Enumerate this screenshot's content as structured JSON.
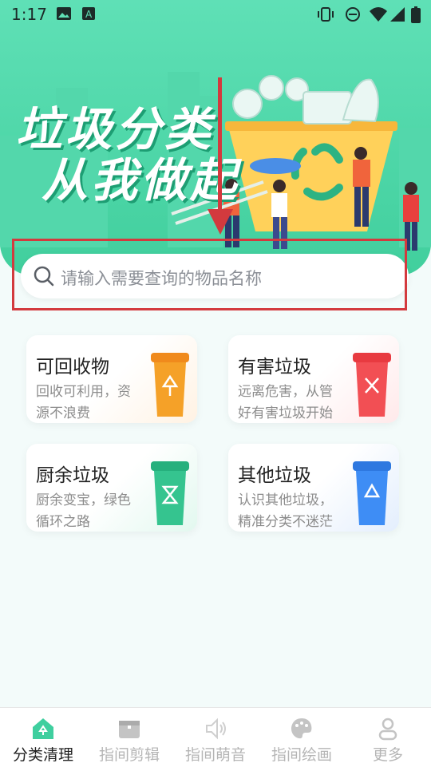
{
  "status_bar": {
    "time": "1:17"
  },
  "banner": {
    "line1": "垃圾分类",
    "line2": "从我做起"
  },
  "search": {
    "placeholder": "请输入需要查询的物品名称"
  },
  "categories": [
    {
      "title": "可回收物",
      "desc": "回收可利用，资源不浪费",
      "color": "#f5a128"
    },
    {
      "title": "有害垃圾",
      "desc": "远离危害，从管好有害垃圾开始",
      "color": "#f24f54"
    },
    {
      "title": "厨余垃圾",
      "desc": "厨余变宝，绿色循环之路",
      "color": "#35c48f"
    },
    {
      "title": "其他垃圾",
      "desc": "认识其他垃圾，精准分类不迷茫",
      "color": "#3e8df5"
    }
  ],
  "tabs": [
    {
      "label": "分类清理"
    },
    {
      "label": "指间剪辑"
    },
    {
      "label": "指间萌音"
    },
    {
      "label": "指间绘画"
    },
    {
      "label": "更多"
    }
  ],
  "colors": {
    "primary": "#3fcf9f",
    "highlight": "#d33a3e"
  }
}
